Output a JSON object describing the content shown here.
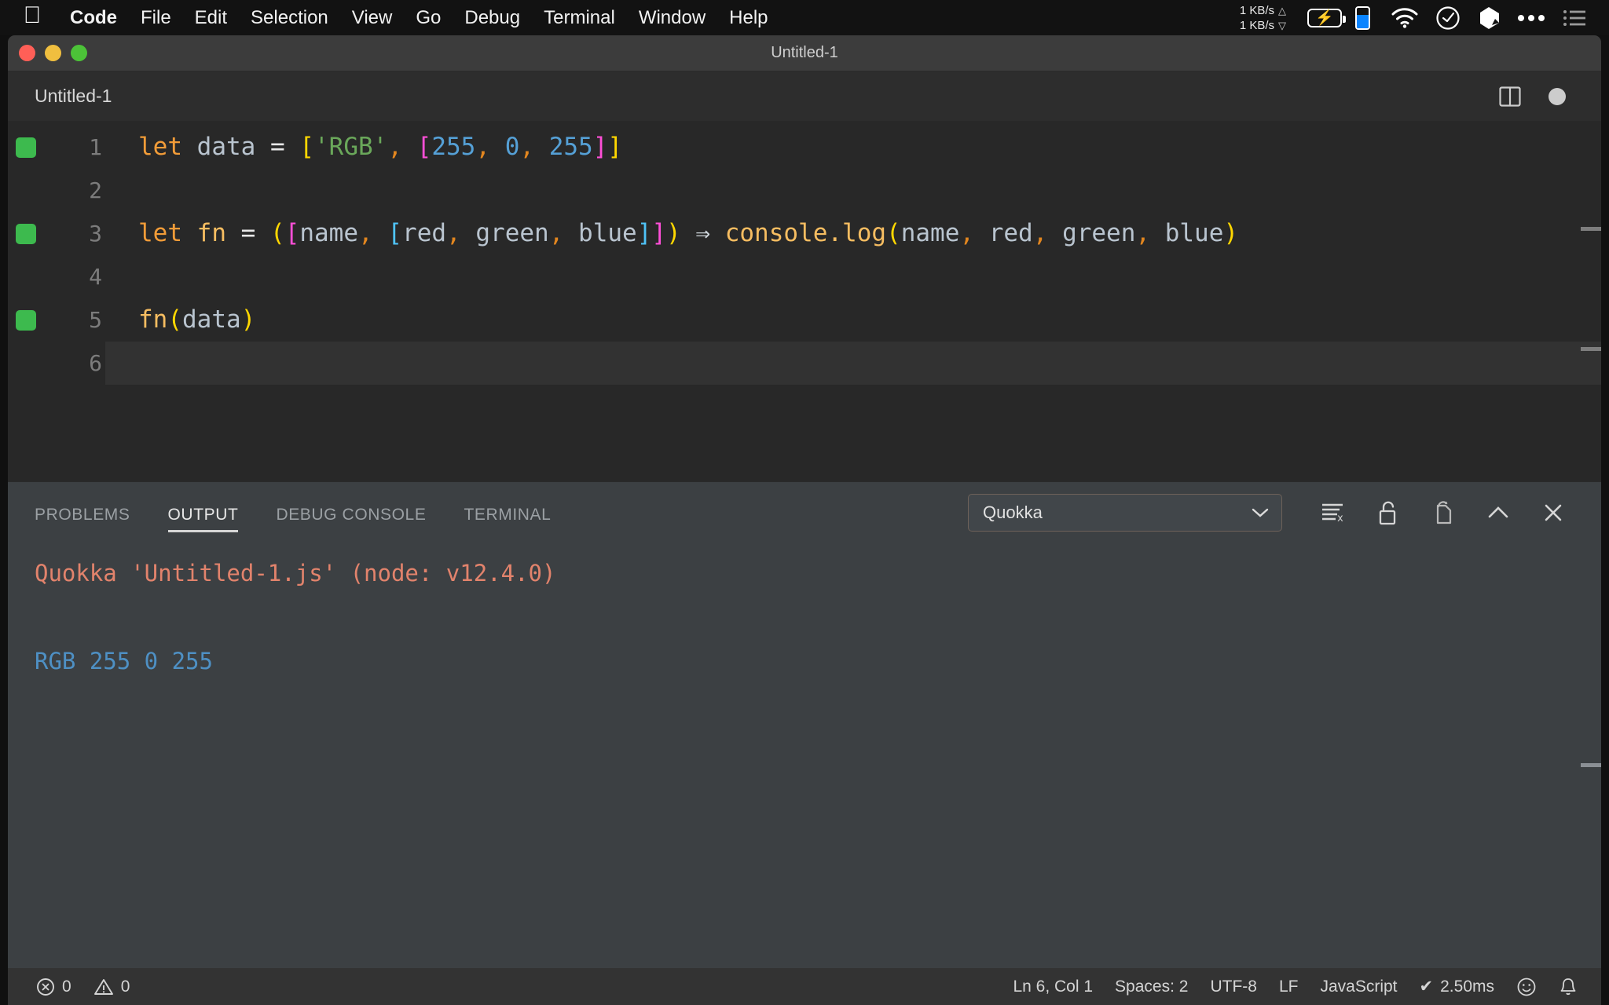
{
  "menubar": {
    "apple_icon": "apple-logo",
    "items": [
      {
        "label": "Code",
        "bold": true
      },
      {
        "label": "File",
        "bold": false
      },
      {
        "label": "Edit",
        "bold": false
      },
      {
        "label": "Selection",
        "bold": false
      },
      {
        "label": "View",
        "bold": false
      },
      {
        "label": "Go",
        "bold": false
      },
      {
        "label": "Debug",
        "bold": false
      },
      {
        "label": "Terminal",
        "bold": false
      },
      {
        "label": "Window",
        "bold": false
      },
      {
        "label": "Help",
        "bold": false
      }
    ],
    "status": {
      "net_up": "1 KB/s",
      "net_down": "1 KB/s",
      "up_arrow": "△",
      "down_arrow": "▽",
      "battery_icon": "battery-charging-icon",
      "phone_battery_icon": "phone-battery-icon",
      "wifi_icon": "wifi-icon",
      "clock_icon": "clock-icon",
      "cube_icon": "dropbox-cube-icon",
      "ellipsis_icon": "ellipsis-icon",
      "list_icon": "control-center-list-icon"
    }
  },
  "window": {
    "title": "Untitled-1",
    "traffic_lights": [
      "close",
      "minimize",
      "zoom"
    ]
  },
  "editor": {
    "tab_label": "Untitled-1",
    "split_icon": "split-editor-icon",
    "dirty_icon": "unsaved-dot-icon",
    "lines": [
      {
        "num": "1",
        "quokka": true,
        "current": false,
        "tokens": [
          {
            "t": "let",
            "c": "t-kw"
          },
          {
            "t": " ",
            "c": "t-op"
          },
          {
            "t": "data",
            "c": "t-var"
          },
          {
            "t": " ",
            "c": "t-op"
          },
          {
            "t": "=",
            "c": "t-op"
          },
          {
            "t": " ",
            "c": "t-op"
          },
          {
            "t": "[",
            "c": "t-y"
          },
          {
            "t": "'RGB'",
            "c": "t-str"
          },
          {
            "t": ",",
            "c": "t-comma"
          },
          {
            "t": " ",
            "c": "t-op"
          },
          {
            "t": "[",
            "c": "t-m"
          },
          {
            "t": "255",
            "c": "t-num"
          },
          {
            "t": ",",
            "c": "t-comma"
          },
          {
            "t": " ",
            "c": "t-op"
          },
          {
            "t": "0",
            "c": "t-num"
          },
          {
            "t": ",",
            "c": "t-comma"
          },
          {
            "t": " ",
            "c": "t-op"
          },
          {
            "t": "255",
            "c": "t-num"
          },
          {
            "t": "]",
            "c": "t-m"
          },
          {
            "t": "]",
            "c": "t-y"
          }
        ]
      },
      {
        "num": "2",
        "quokka": false,
        "current": false,
        "tokens": []
      },
      {
        "num": "3",
        "quokka": true,
        "current": false,
        "tokens": [
          {
            "t": "let",
            "c": "t-kw"
          },
          {
            "t": " ",
            "c": "t-op"
          },
          {
            "t": "fn",
            "c": "t-fn"
          },
          {
            "t": " ",
            "c": "t-op"
          },
          {
            "t": "=",
            "c": "t-op"
          },
          {
            "t": " ",
            "c": "t-op"
          },
          {
            "t": "(",
            "c": "t-y"
          },
          {
            "t": "[",
            "c": "t-m"
          },
          {
            "t": "name",
            "c": "t-var"
          },
          {
            "t": ",",
            "c": "t-comma"
          },
          {
            "t": " ",
            "c": "t-op"
          },
          {
            "t": "[",
            "c": "t-b"
          },
          {
            "t": "red",
            "c": "t-var"
          },
          {
            "t": ",",
            "c": "t-comma"
          },
          {
            "t": " ",
            "c": "t-op"
          },
          {
            "t": "green",
            "c": "t-var"
          },
          {
            "t": ",",
            "c": "t-comma"
          },
          {
            "t": " ",
            "c": "t-op"
          },
          {
            "t": "blue",
            "c": "t-var"
          },
          {
            "t": "]",
            "c": "t-b"
          },
          {
            "t": "]",
            "c": "t-m"
          },
          {
            "t": ")",
            "c": "t-y"
          },
          {
            "t": " ",
            "c": "t-op"
          },
          {
            "t": "⇒",
            "c": "t-arrow"
          },
          {
            "t": " ",
            "c": "t-op"
          },
          {
            "t": "console.log",
            "c": "t-fn"
          },
          {
            "t": "(",
            "c": "t-y"
          },
          {
            "t": "name",
            "c": "t-var"
          },
          {
            "t": ",",
            "c": "t-comma"
          },
          {
            "t": " ",
            "c": "t-op"
          },
          {
            "t": "red",
            "c": "t-var"
          },
          {
            "t": ",",
            "c": "t-comma"
          },
          {
            "t": " ",
            "c": "t-op"
          },
          {
            "t": "green",
            "c": "t-var"
          },
          {
            "t": ",",
            "c": "t-comma"
          },
          {
            "t": " ",
            "c": "t-op"
          },
          {
            "t": "blue",
            "c": "t-var"
          },
          {
            "t": ")",
            "c": "t-y"
          }
        ]
      },
      {
        "num": "4",
        "quokka": false,
        "current": false,
        "tokens": []
      },
      {
        "num": "5",
        "quokka": true,
        "current": false,
        "tokens": [
          {
            "t": "fn",
            "c": "t-fn"
          },
          {
            "t": "(",
            "c": "t-y"
          },
          {
            "t": "data",
            "c": "t-var"
          },
          {
            "t": ")",
            "c": "t-y"
          }
        ]
      },
      {
        "num": "6",
        "quokka": false,
        "current": true,
        "tokens": []
      }
    ]
  },
  "panel": {
    "tabs": [
      {
        "label": "PROBLEMS",
        "active": false
      },
      {
        "label": "OUTPUT",
        "active": true
      },
      {
        "label": "DEBUG CONSOLE",
        "active": false
      },
      {
        "label": "TERMINAL",
        "active": false
      }
    ],
    "channel_select": {
      "value": "Quokka",
      "caret": "chevron-down-icon"
    },
    "tools": [
      {
        "name": "clear-output-icon"
      },
      {
        "name": "lock-open-icon"
      },
      {
        "name": "open-in-editor-icon"
      },
      {
        "name": "maximize-panel-icon"
      },
      {
        "name": "close-panel-icon"
      }
    ],
    "output": {
      "header": "Quokka 'Untitled-1.js' (node: v12.4.0)",
      "result": "RGB 255 0 255"
    }
  },
  "statusbar": {
    "errors_icon": "error-circle-icon",
    "errors": "0",
    "warnings_icon": "warning-triangle-icon",
    "warnings": "0",
    "cursor_position": "Ln 6, Col 1",
    "indentation": "Spaces: 2",
    "encoding": "UTF-8",
    "eol": "LF",
    "language": "JavaScript",
    "quokka_check": "✔",
    "quokka_time": "2.50ms",
    "feedback_icon": "smiley-icon",
    "bell_icon": "bell-icon"
  },
  "colors": {
    "accent_green": "#3dba4e",
    "output_header": "#e2836c",
    "output_value": "#4e90c4",
    "panel_bg": "#3c4043",
    "editor_bg": "#282828"
  }
}
